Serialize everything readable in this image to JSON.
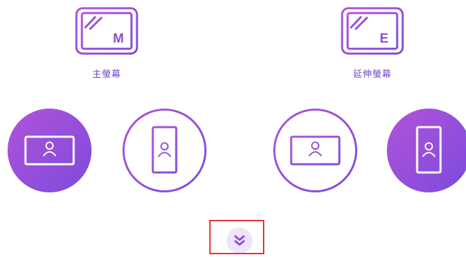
{
  "colors": {
    "gradient_start": "#b153d9",
    "gradient_end": "#7b4bdc",
    "label": "#6e45c9",
    "button_bg": "#ece6fa",
    "highlight": "#e8322b"
  },
  "monitors": [
    {
      "letter": "M",
      "label": "主螢幕",
      "icon": "primary-monitor-icon"
    },
    {
      "letter": "E",
      "label": "延伸螢幕",
      "icon": "extended-monitor-icon"
    }
  ],
  "main_orientation_options": [
    {
      "icon": "landscape-portrait-icon",
      "orientation": "landscape",
      "selected": true
    },
    {
      "icon": "portrait-portrait-icon",
      "orientation": "portrait",
      "selected": false
    }
  ],
  "extended_orientation_options": [
    {
      "icon": "landscape-portrait-icon",
      "orientation": "landscape",
      "selected": false
    },
    {
      "icon": "portrait-portrait-icon",
      "orientation": "portrait",
      "selected": true
    }
  ],
  "expand_button": {
    "icon": "double-chevron-down-icon"
  }
}
